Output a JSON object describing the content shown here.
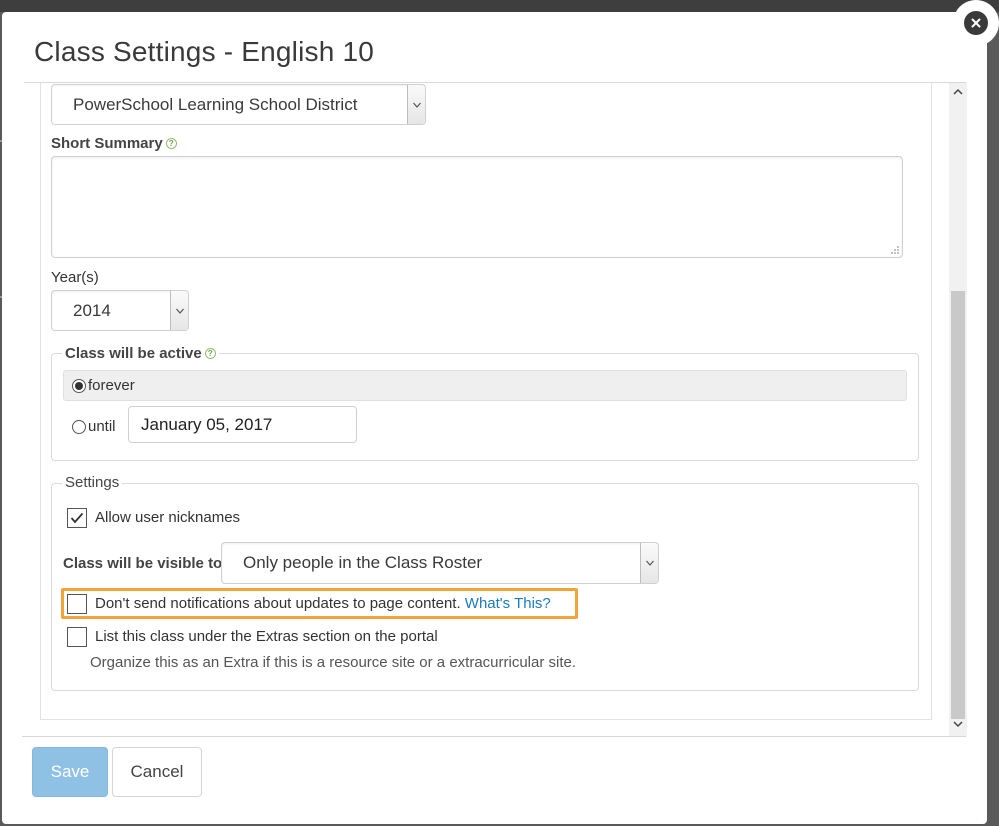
{
  "modal": {
    "title": "Class Settings - English 10"
  },
  "school_select": {
    "value": "PowerSchool Learning School District"
  },
  "short_summary": {
    "label": "Short Summary",
    "value": ""
  },
  "years": {
    "label": "Year(s)",
    "value": "2014"
  },
  "active": {
    "legend": "Class will be active",
    "option_forever": "forever",
    "option_until": "until",
    "selected": "forever",
    "until_date": "January 05, 2017"
  },
  "settings": {
    "legend": "Settings",
    "allow_nicknames": {
      "label": "Allow user nicknames",
      "checked": true
    },
    "visible_to": {
      "label": "Class will be visible to",
      "value": "Only people in the Class Roster"
    },
    "no_notifications": {
      "label": "Don't send notifications about updates to page content.",
      "link": "What's This?",
      "checked": false,
      "highlight_color": "#f2a33a"
    },
    "extras": {
      "label": "List this class under the Extras section on the portal",
      "hint": "Organize this as an Extra if this is a resource site or a extracurricular site.",
      "checked": false
    }
  },
  "footer": {
    "save_label": "Save",
    "cancel_label": "Cancel"
  },
  "colors": {
    "save_button": "#8ec1e4",
    "link": "#1a7bbf"
  }
}
